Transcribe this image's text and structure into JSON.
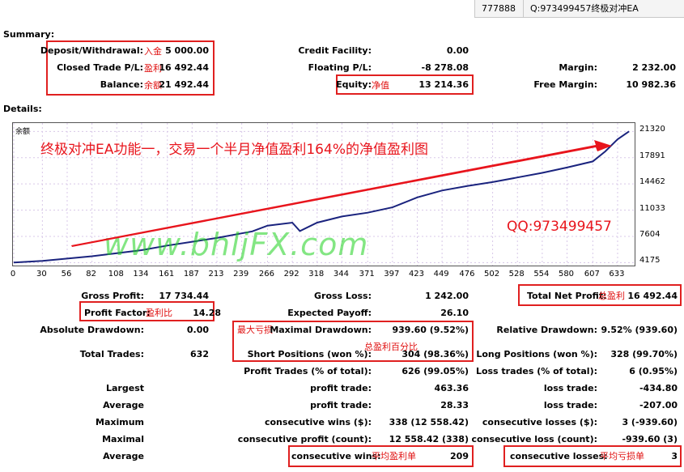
{
  "header": {
    "account": "777888",
    "contact": "Q:973499457终极对冲EA"
  },
  "summary": {
    "title": "Summary:",
    "deposit_label": "Deposit/Withdrawal:",
    "deposit_cn": "入金",
    "deposit_value": "5 000.00",
    "closed_label": "Closed Trade P/L:",
    "closed_cn": "盈利",
    "closed_value": "16 492.44",
    "balance_label": "Balance:",
    "balance_cn": "余额",
    "balance_value": "21 492.44",
    "credit_label": "Credit Facility:",
    "credit_value": "0.00",
    "floating_label": "Floating P/L:",
    "floating_value": "-8 278.08",
    "equity_label": "Equity:",
    "equity_cn": "净值",
    "equity_value": "13 214.36",
    "margin_label": "Margin:",
    "margin_value": "2 232.00",
    "free_margin_label": "Free Margin:",
    "free_margin_value": "10 982.36"
  },
  "details": {
    "title": "Details:"
  },
  "chart_overlay": {
    "legend": "余额",
    "headline": "终极对冲EA功能一，交易一个半月净值盈利164%的净值盈利图",
    "qq": "QQ:973499457",
    "watermark": "www.bhljFX.com"
  },
  "chart_data": {
    "type": "line",
    "series": [
      {
        "name": "余额",
        "color": "#1a237e",
        "x": [
          0,
          30,
          56,
          82,
          108,
          134,
          161,
          187,
          213,
          239,
          250,
          266,
          292,
          300,
          318,
          344,
          371,
          397,
          423,
          449,
          476,
          502,
          528,
          554,
          580,
          607,
          620,
          633,
          645
        ],
        "y": [
          4175,
          4400,
          4700,
          5000,
          5400,
          5800,
          6400,
          6900,
          7400,
          8000,
          8250,
          9000,
          9400,
          8300,
          9400,
          10200,
          10700,
          11400,
          12700,
          13600,
          14200,
          14700,
          15300,
          15900,
          16600,
          17400,
          18700,
          20300,
          21320
        ]
      }
    ],
    "x_ticks": [
      0,
      30,
      56,
      82,
      108,
      134,
      161,
      187,
      213,
      239,
      266,
      292,
      318,
      344,
      371,
      397,
      423,
      449,
      476,
      502,
      528,
      554,
      580,
      607,
      633
    ],
    "y_ticks": [
      4175,
      7604,
      11033,
      14462,
      17891,
      21320
    ],
    "xlim": [
      0,
      650
    ],
    "ylim": [
      4000,
      22200
    ]
  },
  "details_table": {
    "gross_profit_label": "Gross Profit:",
    "gross_profit_value": "17 734.44",
    "gross_loss_label": "Gross Loss:",
    "gross_loss_value": "1 242.00",
    "total_net_label": "Total Net Profit:",
    "total_net_cn": "总盈利",
    "total_net_value": "16 492.44",
    "profit_factor_label": "Profit Factor:",
    "profit_factor_cn": "盈利比",
    "profit_factor_value": "14.28",
    "expected_payoff_label": "Expected Payoff:",
    "expected_payoff_value": "26.10",
    "abs_dd_label": "Absolute Drawdown:",
    "abs_dd_value": "0.00",
    "max_dd_cn": "最大亏损",
    "max_dd_label": "Maximal Drawdown:",
    "max_dd_value": "939.60 (9.52%)",
    "rel_dd_label": "Relative Drawdown:",
    "rel_dd_value": "9.52% (939.60)",
    "win_pct_cn": "总盈利百分比",
    "total_trades_label": "Total Trades:",
    "total_trades_value": "632",
    "short_label": "Short Positions (won %):",
    "short_value": "304 (98.36%)",
    "long_label": "Long Positions (won %):",
    "long_value": "328 (99.70%)",
    "profit_trades_label": "Profit Trades (% of total):",
    "profit_trades_value": "626 (99.05%)",
    "loss_trades_label": "Loss trades (% of total):",
    "loss_trades_value": "6 (0.95%)",
    "rows": [
      {
        "name": "Largest",
        "p_label": "profit trade:",
        "p_value": "463.36",
        "l_label": "loss trade:",
        "l_value": "-434.80"
      },
      {
        "name": "Average",
        "p_label": "profit trade:",
        "p_value": "28.33",
        "l_label": "loss trade:",
        "l_value": "-207.00"
      },
      {
        "name": "Maximum",
        "p_label": "consecutive wins ($):",
        "p_value": "338 (12 558.42)",
        "l_label": "consecutive losses ($):",
        "l_value": "3 (-939.60)"
      },
      {
        "name": "Maximal",
        "p_label": "consecutive profit (count):",
        "p_value": "12 558.42 (338)",
        "l_label": "consecutive loss (count):",
        "l_value": "-939.60 (3)"
      },
      {
        "name": "Average",
        "p_label": "consecutive wins:",
        "p_cn": "平均盈利单",
        "p_value": "209",
        "l_label": "consecutive losses:",
        "l_cn": "平均亏损单",
        "l_value": "3"
      }
    ]
  }
}
